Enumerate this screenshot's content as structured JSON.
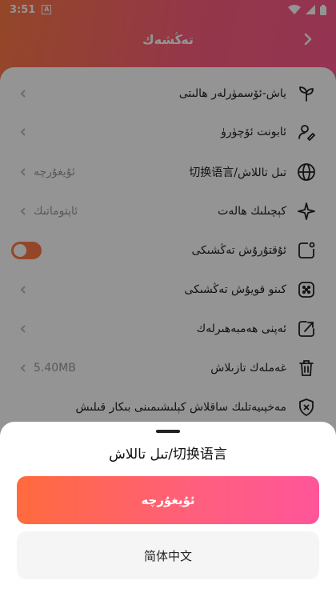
{
  "status_bar": {
    "time": "3:51",
    "notification_letter": "A"
  },
  "header": {
    "title": "تەڭشەك"
  },
  "settings": [
    {
      "label": "ياش-ئۆسمۈرلەر ھالىتى",
      "icon": "sprout-icon"
    },
    {
      "label": "ئابونت ئۆچۈرۈ",
      "icon": "user-edit-icon"
    },
    {
      "label": "تىل تاللاش/切换语言",
      "icon": "globe-icon",
      "value": "ئۇيغۇرچە"
    },
    {
      "label": "كېچىلىك ھالەت",
      "icon": "sparkle-icon",
      "value": "ئاپتوماتىك"
    },
    {
      "label": "ئۇقتۇرۇش تەڭشىكى",
      "icon": "notification-icon",
      "toggle_on": true
    },
    {
      "label": "كىنو قويۇش تەڭشىكى",
      "icon": "dice-icon"
    },
    {
      "label": "ئەپنى ھەمبەھىرلەك",
      "icon": "share-icon"
    },
    {
      "label": "غەملەك تازىلاش",
      "icon": "trash-icon",
      "value": "5.40MB"
    },
    {
      "label": "مەخپىيەتلىك ساقلاش كېلىشىمىنى بىكار قىلىش",
      "icon": "shield-x-icon"
    }
  ],
  "sheet": {
    "title": "تىل تاللاش/切换语言",
    "options": [
      "ئۇيغۇرچە",
      "简体中文"
    ]
  },
  "colors": {
    "accent_start": "#ff6a3d",
    "accent_end": "#ff559a"
  }
}
